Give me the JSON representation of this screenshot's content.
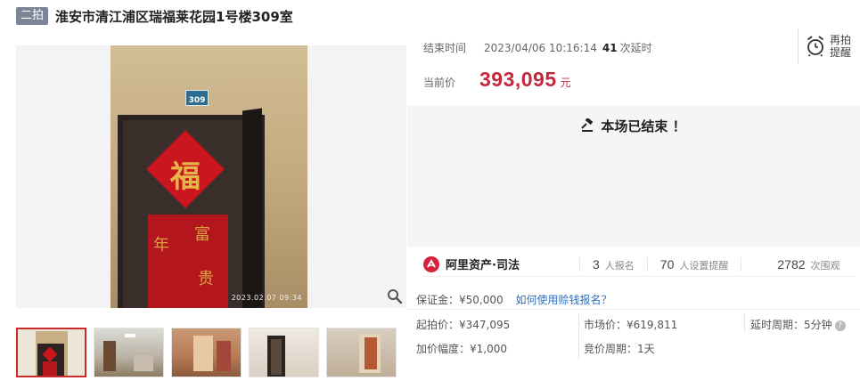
{
  "header": {
    "badge": "二拍",
    "title": "淮安市清江浦区瑞福莱花园1号楼309室"
  },
  "gallery": {
    "door_plate": "309",
    "fu_char": "福",
    "couplet_chars": [
      "年",
      "富",
      "贵"
    ],
    "timestamp": "2023.02.07 09:34",
    "zoom_icon": "magnifier-icon",
    "thumb_count": 5
  },
  "auction": {
    "end_label": "结束时间",
    "end_time": "2023/04/06 10:16:14",
    "delay_count": "41",
    "delay_label": "次延时",
    "remind_line1": "再拍",
    "remind_line2": "提醒",
    "price_label": "当前价",
    "price": "393,095",
    "price_unit": "元",
    "ended_text": "本场已结束 ！"
  },
  "stats": {
    "brand": "阿里资产·司法",
    "signups": "3",
    "signups_label": "人报名",
    "reminders": "70",
    "reminders_label": "人设置提醒",
    "views": "2782",
    "views_label": "次围观"
  },
  "details": {
    "deposit": "保证金：¥50,000",
    "deposit_link": "如何使用赊钱报名？",
    "start_price": "起拍价：¥347,095",
    "market_price": "市场价：¥619,811",
    "delay_period": "延时周期：5分钟",
    "increment": "加价幅度：¥1,000",
    "bid_period": "竞价周期：1天"
  },
  "colors": {
    "price_red": "#c4283c",
    "badge_gray": "#7a8597",
    "link_blue": "#2b6fc2"
  }
}
